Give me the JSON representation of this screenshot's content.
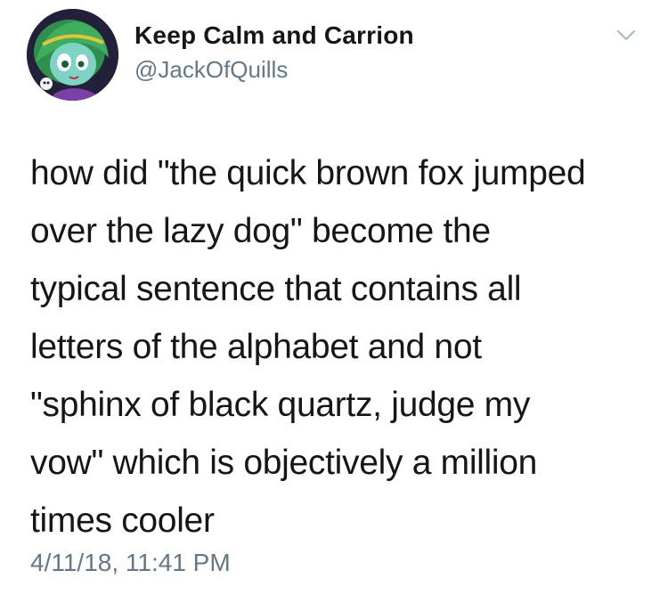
{
  "tweet": {
    "display_name": "Keep Calm and Carrion",
    "handle": "@JackOfQuills",
    "text": "how did \"the quick brown fox jumped\nover the lazy dog\" become the\ntypical sentence that contains all\nletters of the alphabet and not\n\"sphinx of black quartz, judge my\nvow\" which is objectively a million\ntimes cooler",
    "timestamp": "4/11/18, 11:41 PM"
  },
  "icons": {
    "avatar": "profile-avatar",
    "menu": "chevron-down-icon"
  },
  "colors": {
    "text": "#14171a",
    "secondary": "#657786",
    "chevron": "#aab8c2"
  }
}
